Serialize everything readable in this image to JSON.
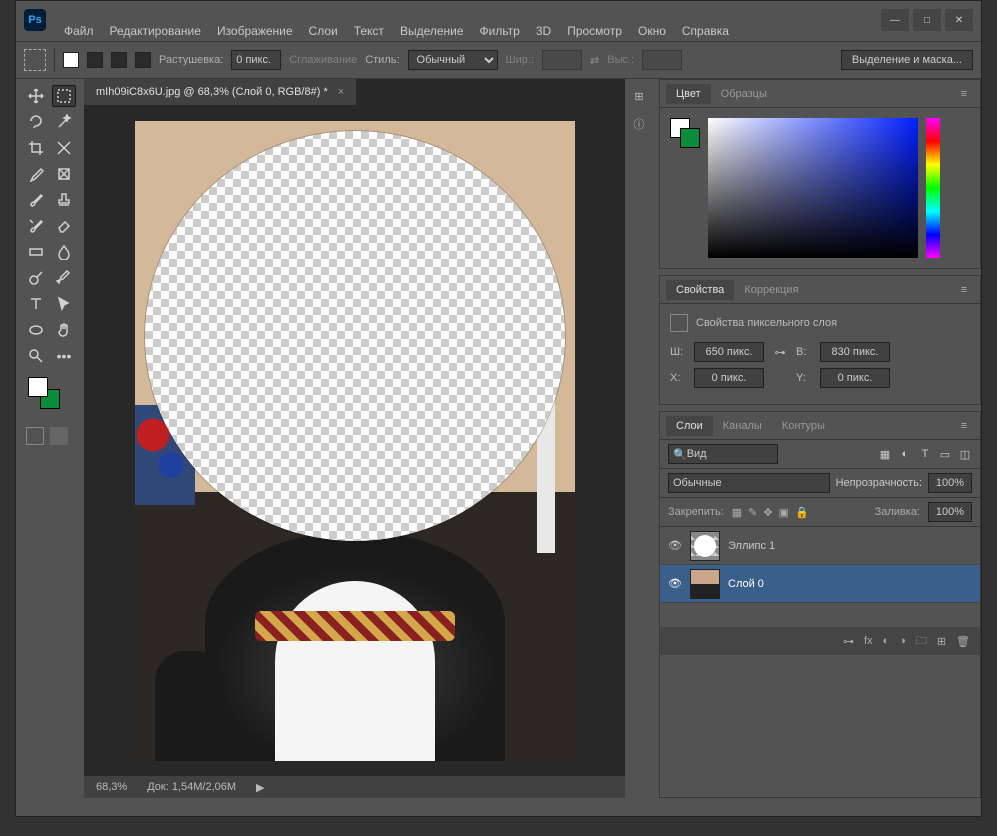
{
  "app": {
    "logo": "Ps"
  },
  "menu": [
    "Файл",
    "Редактирование",
    "Изображение",
    "Слои",
    "Текст",
    "Выделение",
    "Фильтр",
    "3D",
    "Просмотр",
    "Окно",
    "Справка"
  ],
  "options": {
    "feather_label": "Растушевка:",
    "feather_value": "0 пикс.",
    "antialias": "Сглаживание",
    "style_label": "Стиль:",
    "style_value": "Обычный",
    "width_label": "Шир.:",
    "height_label": "Выс.:",
    "mask_btn": "Выделение и маска..."
  },
  "doc": {
    "tab": "mIh09iC8x6U.jpg @ 68,3% (Слой 0, RGB/8#) *",
    "zoom": "68,3%",
    "doc_size_label": "Док:",
    "doc_size": "1,54M/2,06M"
  },
  "color_panel": {
    "tab1": "Цвет",
    "tab2": "Образцы"
  },
  "props_panel": {
    "tab1": "Свойства",
    "tab2": "Коррекция",
    "title": "Свойства пиксельного слоя",
    "w_label": "Ш:",
    "w_value": "650 пикс.",
    "h_label": "В:",
    "h_value": "830 пикс.",
    "x_label": "X:",
    "x_value": "0 пикс.",
    "y_label": "Y:",
    "y_value": "0 пикс."
  },
  "layers_panel": {
    "tab1": "Слои",
    "tab2": "Каналы",
    "tab3": "Контуры",
    "kind_label": "Вид",
    "blend_mode": "Обычные",
    "opacity_label": "Непрозрачность:",
    "opacity": "100%",
    "lock_label": "Закрепить:",
    "fill_label": "Заливка:",
    "fill": "100%",
    "layers": [
      {
        "name": "Эллипс 1"
      },
      {
        "name": "Слой 0"
      }
    ]
  }
}
